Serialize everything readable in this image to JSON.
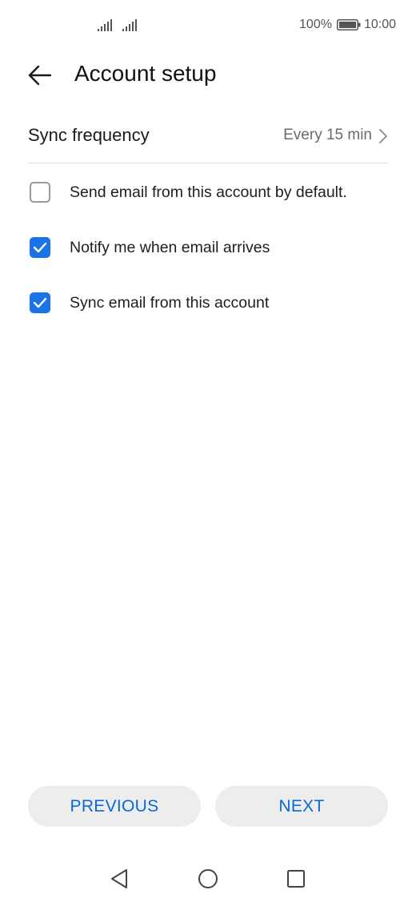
{
  "status_bar": {
    "battery_percent": "100%",
    "time": "10:00",
    "signal_icon": "signal-icon",
    "battery_icon": "battery-icon"
  },
  "header": {
    "title": "Account setup",
    "back_icon": "arrow-left-icon"
  },
  "sync_frequency": {
    "label": "Sync frequency",
    "value": "Every 15 min",
    "icon": "chevron-right-icon"
  },
  "options": [
    {
      "label": "Send email from this account by default.",
      "checked": false
    },
    {
      "label": "Notify me when email arrives",
      "checked": true
    },
    {
      "label": "Sync email from this account",
      "checked": true
    }
  ],
  "buttons": {
    "previous": "PREVIOUS",
    "next": "NEXT"
  },
  "colors": {
    "accent": "#1a73e8",
    "button_text": "#0a69d6",
    "button_bg": "#ededed"
  },
  "nav_bar": {
    "back_icon": "triangle-back-icon",
    "home_icon": "circle-home-icon",
    "recent_icon": "square-recent-icon"
  }
}
